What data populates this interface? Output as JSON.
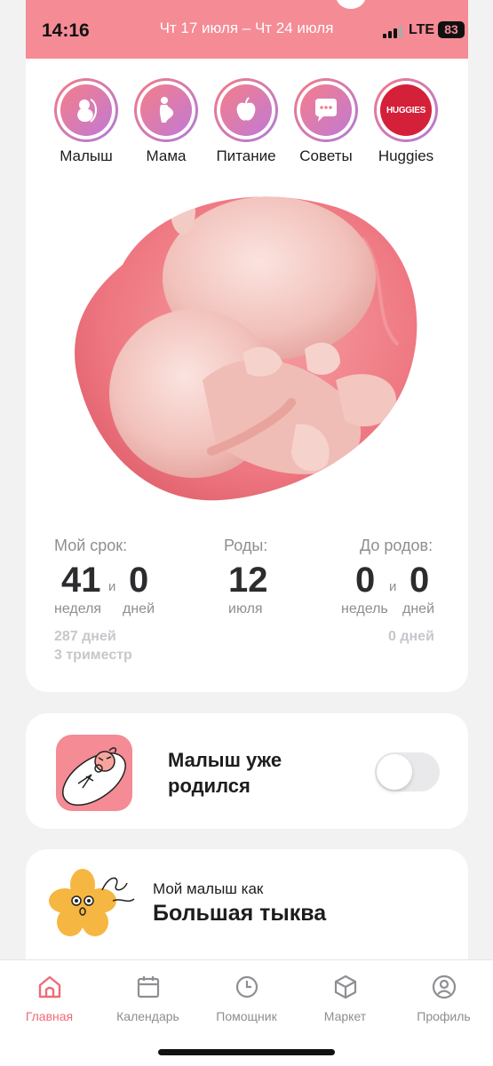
{
  "status": {
    "time": "14:16",
    "network": "LTE",
    "battery": "83"
  },
  "header": {
    "week_range": "Чт 17 июля – Чт 24 июля"
  },
  "categories": [
    {
      "label": "Малыш",
      "icon": "fetus-icon"
    },
    {
      "label": "Мама",
      "icon": "pregnant-woman-icon"
    },
    {
      "label": "Питание",
      "icon": "apple-icon"
    },
    {
      "label": "Советы",
      "icon": "chat-bubble-icon"
    },
    {
      "label": "Huggies",
      "icon": "huggies-logo",
      "logo_text": "HUGGIES"
    }
  ],
  "stats": {
    "term": {
      "label": "Мой срок:",
      "weeks": "41",
      "and": "и",
      "days": "0",
      "weeks_unit": "неделя",
      "days_unit": "дней",
      "total_days": "287 дней",
      "trimester": "3 триместр"
    },
    "birth": {
      "label": "Роды:",
      "day": "12",
      "month": "июля"
    },
    "until": {
      "label": "До родов:",
      "weeks": "0",
      "and": "и",
      "days": "0",
      "weeks_unit": "недель",
      "days_unit": "дней",
      "total_days": "0 дней"
    }
  },
  "born_card": {
    "title": "Малыш уже родился",
    "toggle_on": false
  },
  "size_card": {
    "subtitle": "Мой малыш как",
    "title": "Большая тыква"
  },
  "tabs": [
    {
      "label": "Главная",
      "icon": "home-icon",
      "active": true
    },
    {
      "label": "Календарь",
      "icon": "calendar-icon",
      "active": false
    },
    {
      "label": "Помощник",
      "icon": "clock-icon",
      "active": false
    },
    {
      "label": "Маркет",
      "icon": "box-icon",
      "active": false
    },
    {
      "label": "Профиль",
      "icon": "profile-icon",
      "active": false
    }
  ],
  "colors": {
    "accent": "#f48b95",
    "active_tab": "#f06a78",
    "gradient_end": "#b07ad8"
  }
}
